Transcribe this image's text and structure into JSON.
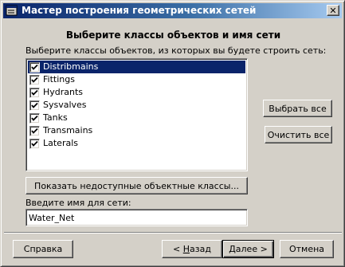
{
  "window": {
    "title": "Мастер построения геометрических сетей",
    "close_glyph": "✕"
  },
  "heading": "Выберите классы объектов и имя сети",
  "class_list": {
    "label": "Выберите классы объектов, из которых вы будете строить сеть:",
    "items": [
      {
        "label": "Distribmains",
        "checked": true,
        "selected": true
      },
      {
        "label": "Fittings",
        "checked": true,
        "selected": false
      },
      {
        "label": "Hydrants",
        "checked": true,
        "selected": false
      },
      {
        "label": "Sysvalves",
        "checked": true,
        "selected": false
      },
      {
        "label": "Tanks",
        "checked": true,
        "selected": false
      },
      {
        "label": "Transmains",
        "checked": true,
        "selected": false
      },
      {
        "label": "Laterals",
        "checked": true,
        "selected": false
      }
    ]
  },
  "buttons": {
    "select_all": "Выбрать все",
    "clear_all": "Очистить все",
    "show_unavailable": "Показать недоступные объектные классы...",
    "help": "Справка",
    "back_prefix": "< ",
    "back_mnemonic": "Н",
    "back_rest": "азад",
    "next_mnemonic": "Д",
    "next_rest": "алее",
    "next_suffix": " >",
    "cancel": "Отмена"
  },
  "network_name": {
    "label": "Введите имя для сети:",
    "value": "Water_Net"
  },
  "colors": {
    "title_bar_start": "#0a246a",
    "title_bar_end": "#a6caf0",
    "selection": "#0a246a",
    "face": "#d4d0c8"
  }
}
